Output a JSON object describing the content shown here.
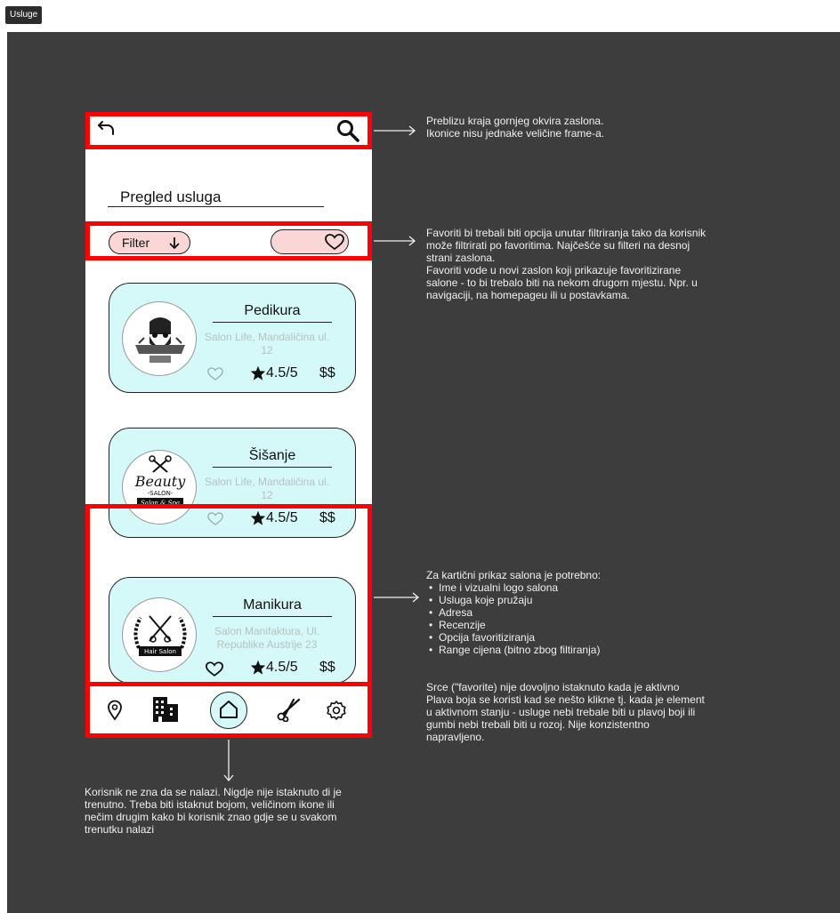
{
  "frame": {
    "label": "Usluge"
  },
  "header": {
    "back_icon": "back-arrow-icon",
    "search_icon": "search-icon"
  },
  "page": {
    "title": "Pregled usluga"
  },
  "filter": {
    "label": "Filter",
    "sort_icon": "arrow-down-icon",
    "favorites_icon": "heart-icon"
  },
  "cards": [
    {
      "name": "Pedikura",
      "address": "Salon Life, Mandaličina ul. 12",
      "rating": "4.5/5",
      "price": "$$",
      "logo": "barber-shop-logo"
    },
    {
      "name": "Šišanje",
      "address": "Salon Life, Mandaličina ul. 12",
      "rating": "4.5/5",
      "price": "$$",
      "logo": "beauty-salon-logo"
    },
    {
      "name": "Manikura",
      "address": "Salon Manifaktura, Ul. Republike Austrije 23",
      "rating": "4.5/5",
      "price": "$$",
      "logo": "hair-salon-logo"
    }
  ],
  "nav": {
    "items": [
      "location-icon",
      "building-icon",
      "home-icon",
      "scissors-icon",
      "settings-icon"
    ]
  },
  "colors": {
    "canvas": "#3d3d3d",
    "highlight": "#ff0000",
    "card_bg": "#d5f8f8",
    "pill_bg": "#fbd6d6"
  },
  "notes": {
    "top": "Preblizu kraja gornjeg okvira zaslona.\nIkonice nisu jednake veličine frame-a.",
    "filter": "Favoriti bi trebali biti opcija unutar filtriranja tako da korisnik\nmože filtrirati po favoritima. Najčešće su filteri na desnoj\nstrani zaslona.\nFavoriti vode u novi zaslon koji prikazuje favoritizirane\nsalone - to bi trebalo biti na nekom drugom mjestu. Npr. u\nnavigaciji, na homepageu ili u postavkama.",
    "cards_intro": "Za kartični prikaz salona je potrebno:",
    "cards_list": [
      "Ime i vizualni logo salona",
      "Usluga koje pružaju",
      "Adresa",
      "Recenzije",
      "Opcija favoritiziranja",
      "Range cijena (bitno zbog filtiranja)"
    ],
    "cards_extra": "Srce (\"favorite) nije dovoljno istaknuto kada je aktivno\nPlava boja se koristi kad se nešto klikne tj. kada je element\nu aktivnom stanju - usluge nebi trebale biti u plavoj boji ili\ngumbi nebi trebali biti u rozoj. Nije konzistentno\nnapravljeno.",
    "nav": "Korisnik ne zna da se nalazi. Nigdje nije istaknuto di je\ntrenutno. Treba biti istaknut bojom, veličinom ikone ili\nnečim drugim kako bi korisnik znao gdje se u svakom\ntrenutku nalazi"
  }
}
